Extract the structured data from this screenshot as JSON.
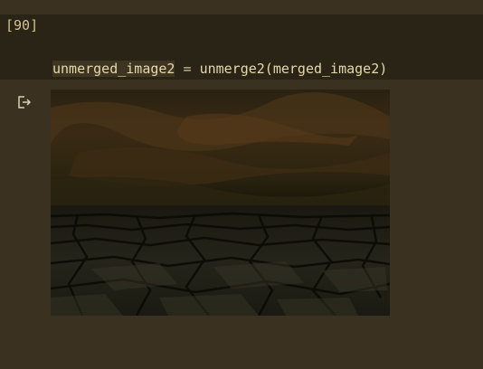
{
  "cell": {
    "execution_count": "[90]",
    "line1": {
      "var": "unmerged_image2",
      "op": " = ",
      "call": "unmerge2(merged_image2)"
    },
    "line2": {
      "var": "unmerged_image2"
    }
  },
  "output": {
    "icon": "output-redirect-icon"
  },
  "colors": {
    "background": "#3a3120",
    "cell_background": "#2a2417",
    "code_text": "#e6d8a8",
    "variable_highlight": "#3d3522"
  }
}
